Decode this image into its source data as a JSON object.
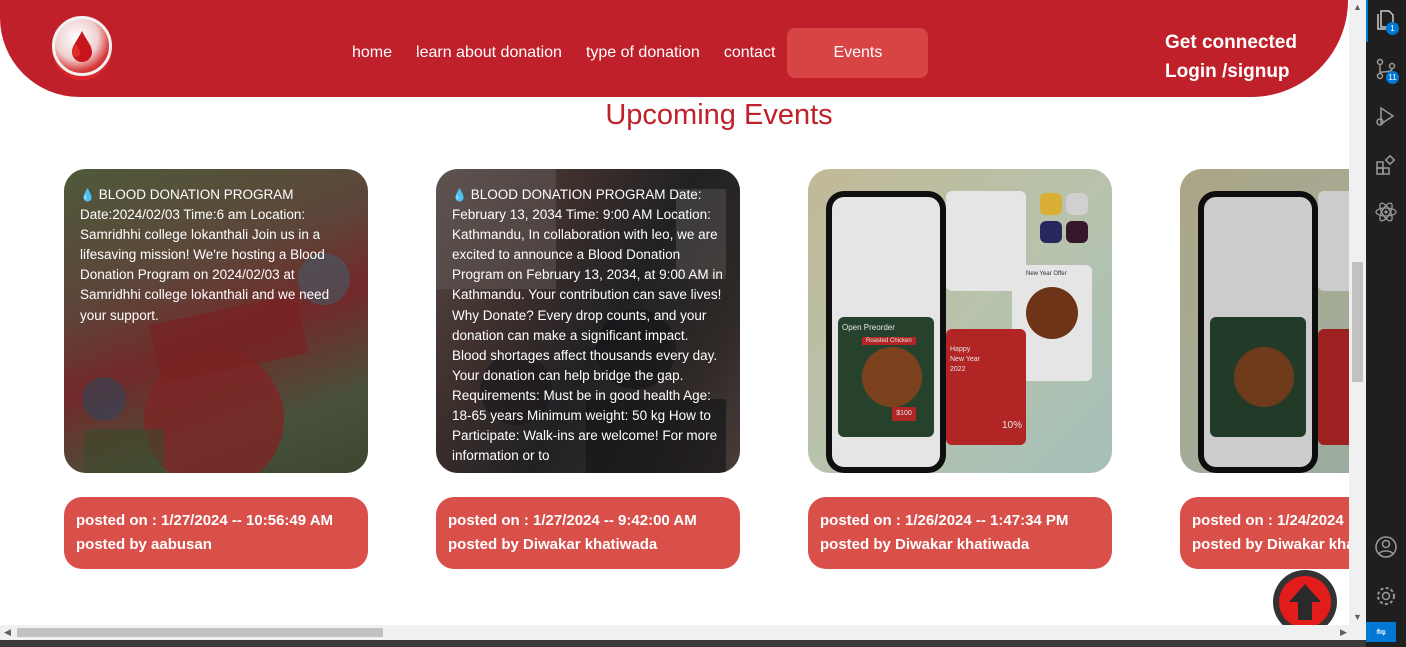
{
  "nav": {
    "items": [
      "home",
      "learn about donation",
      "type of donation",
      "contact"
    ],
    "active": "Events"
  },
  "header_right": {
    "connect": "Get connected",
    "login": "Login /signup"
  },
  "page_title": "Upcoming Events",
  "events": [
    {
      "text": "BLOOD DONATION PROGRAM Date:2024/02/03 Time:6 am Location: Samridhhi college lokanthali Join us in a lifesaving mission! We're hosting a Blood Donation Program on 2024/02/03 at Samridhhi college lokanthali and we need your support.",
      "posted_on": "posted on : 1/27/2024 -- 10:56:49 AM",
      "posted_by": "posted by aabusan"
    },
    {
      "text": "BLOOD DONATION PROGRAM Date: February 13, 2034 Time: 9:00 AM Location: Kathmandu, In collaboration with leo, we are excited to announce a Blood Donation Program on February 13, 2034, at 9:00 AM in Kathmandu. Your contribution can save lives! Why Donate? Every drop counts, and your donation can make a significant impact. Blood shortages affect thousands every day. Your donation can help bridge the gap. Requirements: Must be in good health Age: 18-65 years Minimum weight: 50 kg How to Participate: Walk-ins are welcome! For more information or to",
      "posted_on": "posted on : 1/27/2024 -- 9:42:00 AM",
      "posted_by": "posted by Diwakar khatiwada"
    },
    {
      "text": "",
      "posted_on": "posted on : 1/26/2024 -- 1:47:34 PM",
      "posted_by": "posted by Diwakar khatiwada"
    },
    {
      "text": "",
      "posted_on": "posted on : 1/24/2024",
      "posted_by": "posted by Diwakar khatiwada"
    }
  ],
  "mockup_text": {
    "open_preorder": "Open Preorder",
    "roasted_chicken": "Roasted Chicken",
    "new_year_offer": "New Year Offer",
    "happy_new_year": "Happy New Year 2022",
    "discount": "10%",
    "price": "$100"
  },
  "activity_badges": {
    "explorer": "1",
    "source_control": "11"
  },
  "colors": {
    "brand_red": "#c0202a",
    "card_meta": "#d9504b",
    "nav_active": "#d84444"
  }
}
